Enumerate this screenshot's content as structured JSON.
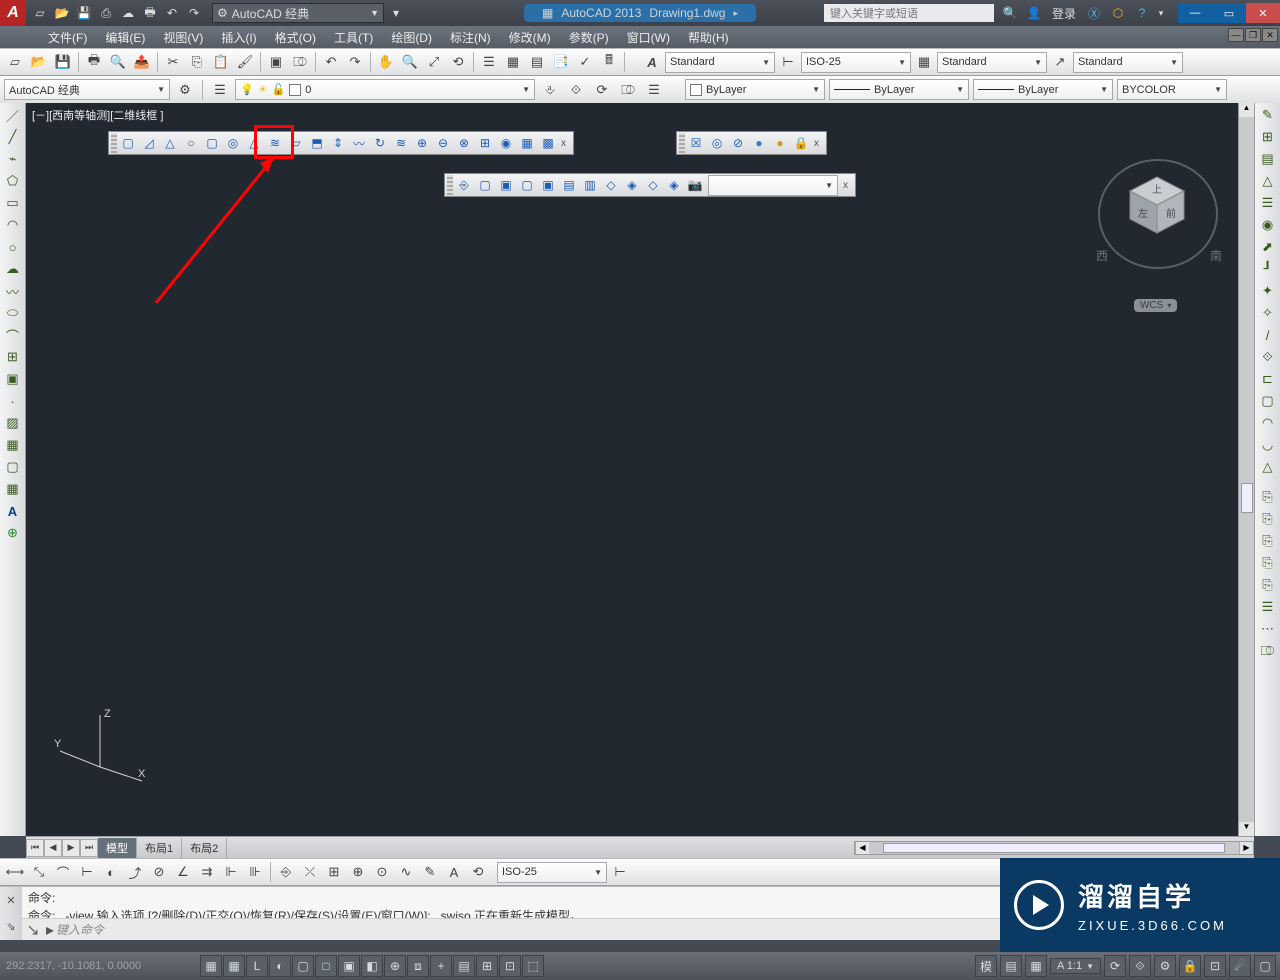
{
  "title": {
    "app": "AutoCAD 2013",
    "doc": "Drawing1.dwg",
    "waffle": "▦"
  },
  "search_placeholder": "键入关键字或短语",
  "login_label": "登录",
  "workspace_dd": "AutoCAD 经典",
  "menus": [
    "文件(F)",
    "编辑(E)",
    "视图(V)",
    "插入(I)",
    "格式(O)",
    "工具(T)",
    "绘图(D)",
    "标注(N)",
    "修改(M)",
    "参数(P)",
    "窗口(W)",
    "帮助(H)"
  ],
  "ws_sel": "AutoCAD 经典",
  "layer_current": "0",
  "style_text": "Standard",
  "style_dim": "ISO-25",
  "style_table": "Standard",
  "style_ml": "Standard",
  "color_dd": "ByLayer",
  "ltype_dd": "ByLayer",
  "plot_dd": "BYCOLOR",
  "viewport_tag": "[－][西南等轴测][二维线框 ]",
  "wcs_label": "WCS",
  "ucs": {
    "x": "X",
    "y": "Y",
    "z": "Z"
  },
  "tabs": {
    "nav": [
      "⏮",
      "◀",
      "▶",
      "⏭"
    ],
    "model": "模型",
    "layout1": "布局1",
    "layout2": "布局2"
  },
  "dimstyle_dd": "ISO-25",
  "cmd": {
    "l1": "命令:",
    "l2": "命令: _-view 输入选项 [?/删除(D)/正交(O)/恢复(R)/保存(S)/设置(E)/窗口(W)]: _swiso 正在重新生成模型。",
    "prompt": "键入命令",
    "caret": "↘",
    "lbl": "⇘"
  },
  "coords": "292.2317, -10.1081, 0.0000",
  "status": {
    "scale": "A 1:1",
    "glyphs": [
      "模",
      "▦",
      "▦",
      "L",
      "◐",
      "▢",
      "□",
      "▣",
      "◧",
      "⊕",
      "⧈",
      "+",
      "▤",
      "⊞",
      "⊡",
      "⬚"
    ]
  },
  "right_tools": [
    "✎",
    "⊞",
    "▤",
    "△",
    "☰",
    "◉",
    "⬈",
    "┚",
    "✦",
    "✧",
    "/",
    "⟐",
    "⊏",
    "▢",
    "◠",
    "◡",
    "△",
    "✕",
    "≡",
    "⎄",
    "⊿",
    "⟐"
  ],
  "right_tools2": [
    "⎘",
    "⎘",
    "⎘",
    "⎘",
    "⎘",
    "☰",
    "⋯",
    "⎄"
  ],
  "watermark": {
    "cn": "溜溜自学",
    "url": "ZIXUE.3D66.COM"
  },
  "viewcube": {
    "top": "上",
    "left": "左",
    "front": "前",
    "compass": [
      "西",
      "南"
    ]
  }
}
